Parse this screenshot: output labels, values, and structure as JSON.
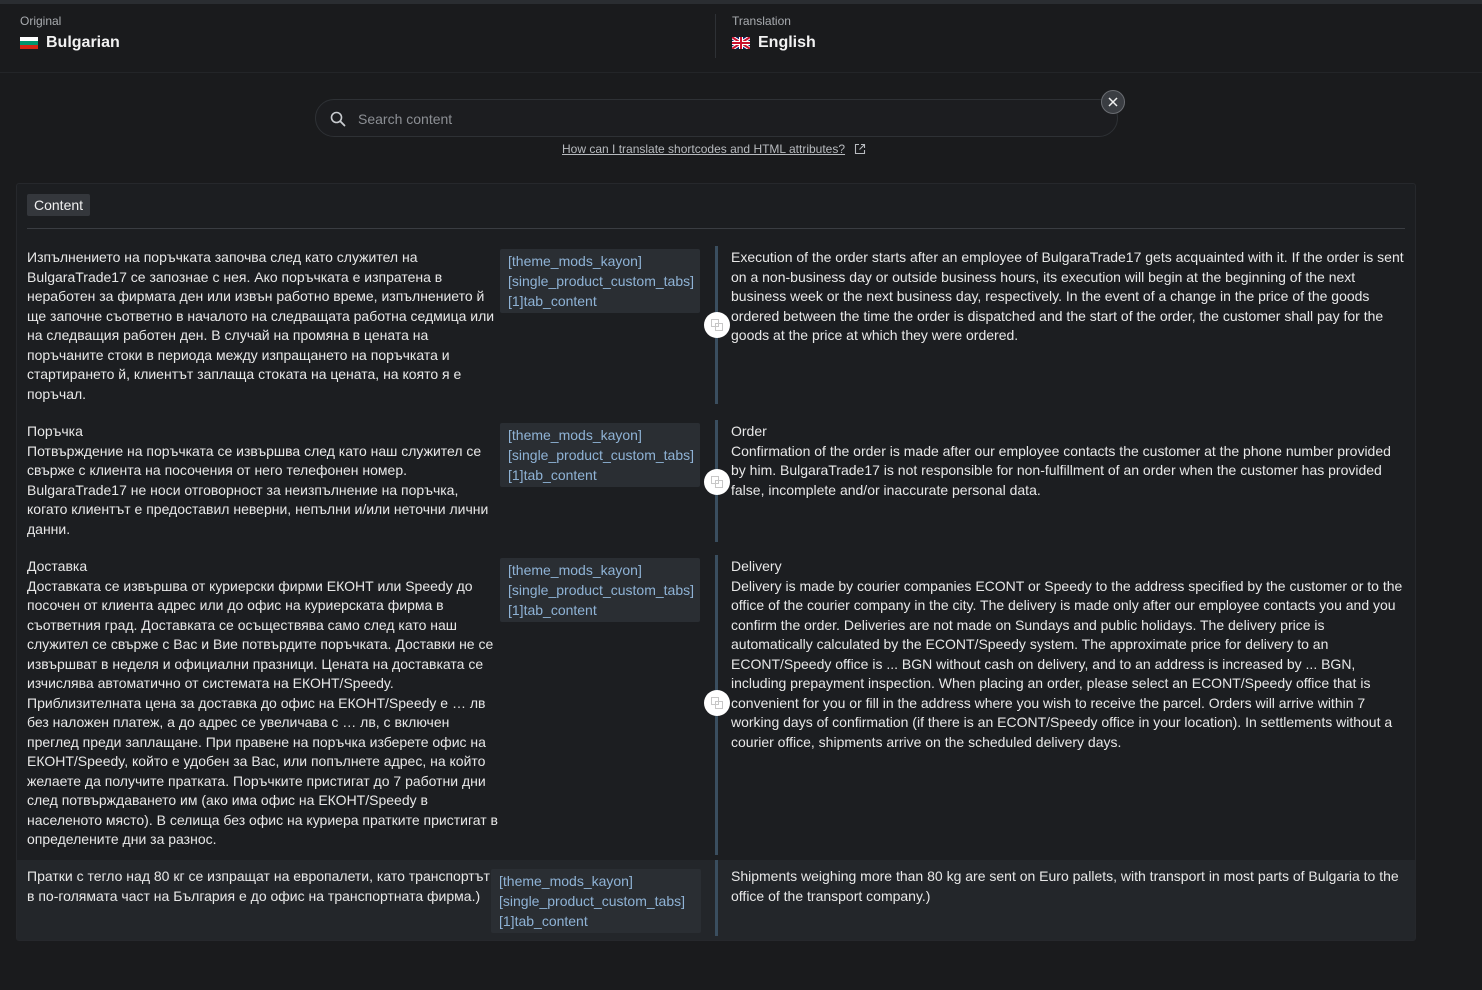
{
  "header": {
    "original_label": "Original",
    "original_language": "Bulgarian",
    "translation_label": "Translation",
    "translation_language": "English"
  },
  "search": {
    "placeholder": "Search content",
    "help_link": "How can I translate shortcodes and HTML attributes?"
  },
  "tabs": {
    "content": "Content"
  },
  "rows": [
    {
      "source": "Изпълнението на поръчката започва след като служител на BulgaraTrade17 се запознае с нея. Ако поръчката е изпратена в неработен за фирмата ден или извън работно време, изпълнението й ще започне съответно в началото на следващата работна седмица или на следващия работен ден. В случай на промяна в цената на поръчаните стоки в периода между изпращането на поръчката и стартирането й, клиентът заплаща стоката на цената, на която я е поръчал.",
      "context": [
        "[theme_mods_kayon]",
        "[single_product_custom_tabs]",
        "[1]tab_content"
      ],
      "target": "Execution of the order starts after an employee of BulgaraTrade17 gets acquainted with it. If the order is sent on a non-business day or outside business hours, its execution will begin at the beginning of the next business week or the next business day, respectively. In the event of a change in the price of the goods ordered between the time the order is dispatched and the start of the order, the customer shall pay for the goods at the price at which they were ordered."
    },
    {
      "source_title": "Поръчка",
      "source": "Потвърждение на поръчката се извършва след като наш служител се свърже с клиента на посочения от него телефонен номер. BulgaraTrade17 не носи отговорност за неизпълнение на поръчка, когато клиентът е предоставил неверни, непълни и/или неточни лични данни.",
      "context": [
        "[theme_mods_kayon]",
        "[single_product_custom_tabs]",
        "[1]tab_content"
      ],
      "target_title": "Order",
      "target": "Confirmation of the order is made after our employee contacts the customer at the phone number provided by him. BulgaraTrade17 is not responsible for non-fulfillment of an order when the customer has provided false, incomplete and/or inaccurate personal data."
    },
    {
      "source_title": "Доставка",
      "source": "Доставката се извършва от куриерски фирми ЕКОНТ или Speedy до посочен от клиента адрес или до офис на куриерската фирма в съответния град. Доставката се осъществява само след като наш служител се свърже с Вас и Вие потвърдите поръчката. Доставки не се извършват в неделя и официални празници. Цената на доставката се изчислява автоматично от системата на ЕКОНТ/Speedy. Приблизителната цена за доставка до офис на ЕКОНТ/Speedy е … лв без наложен платеж, а до адрес се увеличава с … лв, с включен преглед преди заплащане. При правене на поръчка изберете офис на ЕКОНТ/Speedy, който е удобен за Вас, или попълнете адрес, на който желаете да получите пратката. Поръчките пристигат до 7 работни дни след потвърждаването им (ако има офис на ЕКОНТ/Speedy в населеното място). В селища без офис на куриера пратките пристигат в определените дни за разнос.",
      "context": [
        "[theme_mods_kayon]",
        "[single_product_custom_tabs]",
        "[1]tab_content"
      ],
      "target_title": "Delivery",
      "target": "Delivery is made by courier companies ECONT or Speedy to the address specified by the customer or to the office of the courier company in the city. The delivery is made only after our employee contacts you and you confirm the order. Deliveries are not made on Sundays and public holidays. The delivery price is automatically calculated by the ECONT/Speedy system. The approximate price for delivery to an ECONT/Speedy office is ... BGN without cash on delivery, and to an address is increased by ... BGN, including prepayment inspection. When placing an order, please select an ECONT/Speedy office that is convenient for you or fill in the address where you wish to receive the parcel. Orders will arrive within 7 working days of confirmation (if there is an ECONT/Speedy office in your location). In settlements without a courier office, shipments arrive on the scheduled delivery days."
    },
    {
      "source": "Пратки с тегло над 80 кг се изпращат на европалети, като транспортът в по-голямата част на България е до офис на транспортната фирма.)",
      "context": [
        "[theme_mods_kayon]",
        "[single_product_custom_tabs]",
        "[1]tab_content"
      ],
      "target": "Shipments weighing more than 80 kg are sent on Euro pallets, with transport in most parts of Bulgaria to the office of the transport company.)"
    }
  ]
}
